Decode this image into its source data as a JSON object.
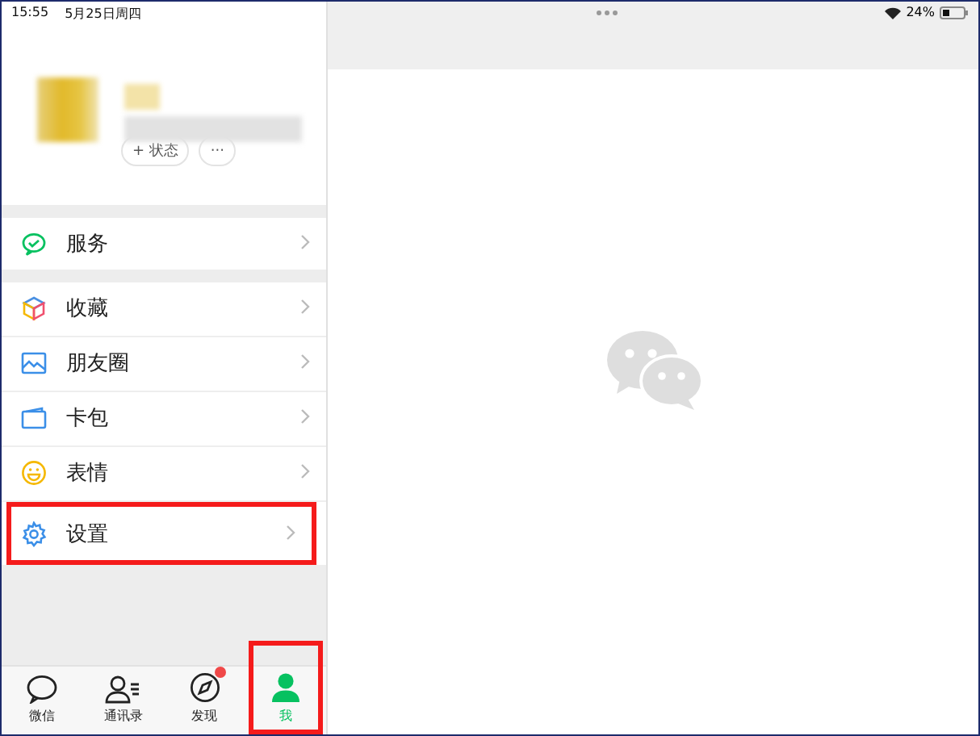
{
  "status_bar": {
    "time": "15:55",
    "date": "5月25日周四",
    "battery": "24%"
  },
  "profile": {
    "status_button": "+ 状态",
    "more_button": "···"
  },
  "menu_groups": [
    [
      {
        "kind": "service",
        "label": "服务",
        "highlighted": false
      }
    ],
    [
      {
        "kind": "favorites",
        "label": "收藏",
        "highlighted": false
      },
      {
        "kind": "moments",
        "label": "朋友圈",
        "highlighted": false
      },
      {
        "kind": "cards",
        "label": "卡包",
        "highlighted": false
      },
      {
        "kind": "stickers",
        "label": "表情",
        "highlighted": false
      },
      {
        "kind": "settings",
        "label": "设置",
        "highlighted": true
      }
    ]
  ],
  "tabs": [
    {
      "kind": "chats",
      "label": "微信",
      "selected": false,
      "badge": false,
      "highlighted": false
    },
    {
      "kind": "contacts",
      "label": "通讯录",
      "selected": false,
      "badge": false,
      "highlighted": false
    },
    {
      "kind": "discover",
      "label": "发现",
      "selected": false,
      "badge": true,
      "highlighted": false
    },
    {
      "kind": "me",
      "label": "我",
      "selected": true,
      "badge": false,
      "highlighted": true
    }
  ]
}
